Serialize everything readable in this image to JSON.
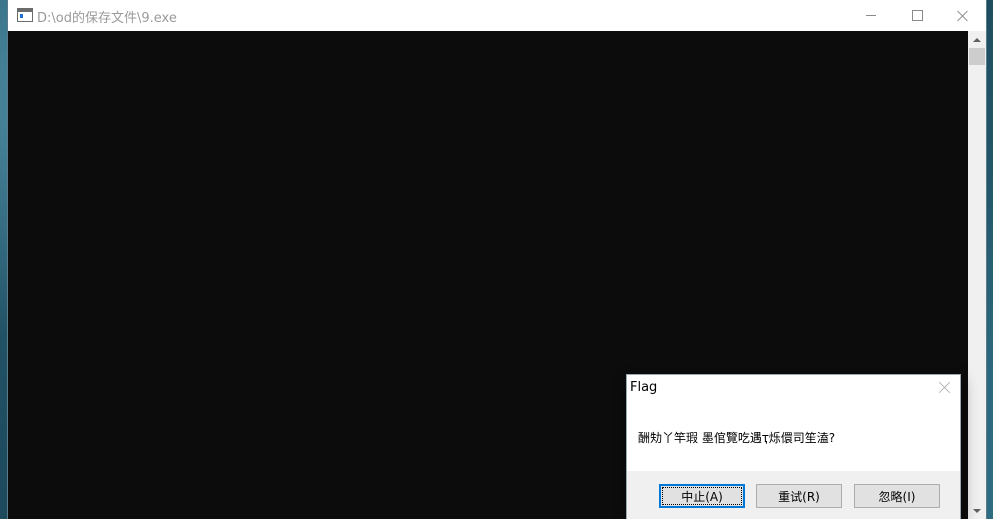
{
  "console_window": {
    "title": "D:\\od的保存文件\\9.exe",
    "icon": "console-app-icon",
    "caption_buttons": [
      "minimize-icon",
      "maximize-icon",
      "close-icon"
    ]
  },
  "message_box": {
    "title": "Flag",
    "message": "酬劮丫竿瑕 墨倌覽吃遇ҭ烁儇司笙溘?",
    "buttons": {
      "abort": "中止(A)",
      "retry": "重试(R)",
      "ignore": "忽略(I)"
    }
  },
  "colors": {
    "console_background": "#0c0c0c",
    "titlebar_background": "#ffffff",
    "focus_accent": "#0078d7"
  }
}
